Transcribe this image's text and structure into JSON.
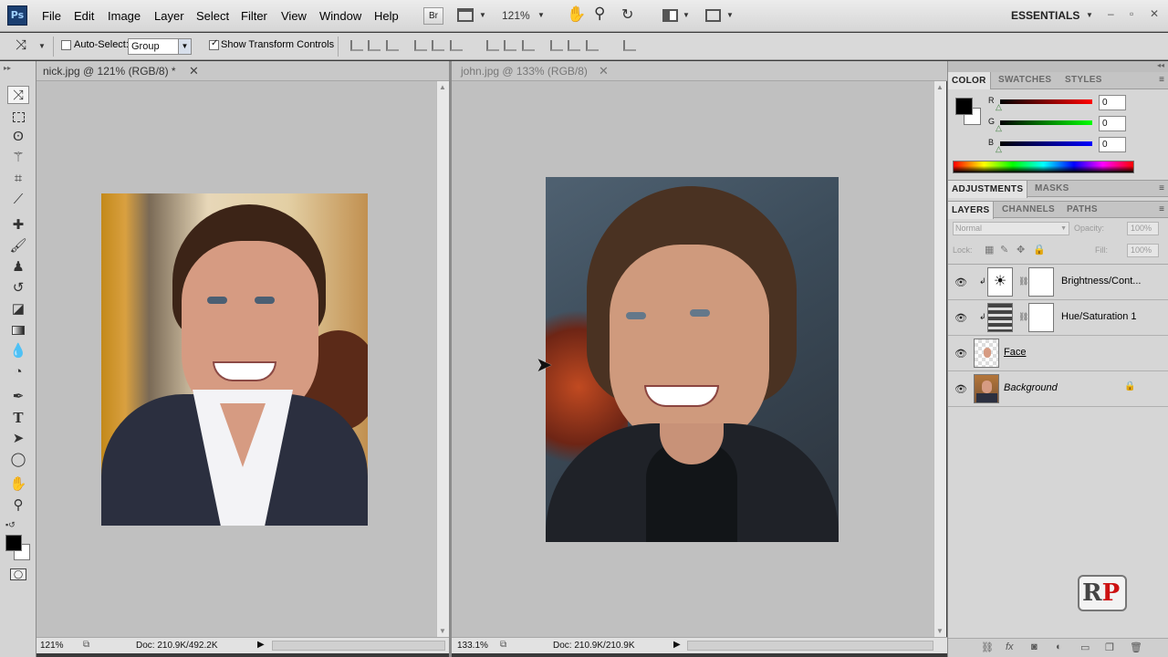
{
  "app": {
    "logo": "Ps"
  },
  "menu": [
    "File",
    "Edit",
    "Image",
    "Layer",
    "Select",
    "Filter",
    "View",
    "Window",
    "Help"
  ],
  "menubar": {
    "br_label": "Br",
    "zoom": "121%",
    "workspace": "ESSENTIALS"
  },
  "options": {
    "auto_select_label": "Auto-Select:",
    "auto_select_checked": false,
    "group_value": "Group",
    "show_transform_label": "Show Transform Controls",
    "show_transform_checked": true
  },
  "doc1": {
    "title": "nick.jpg @ 121% (RGB/8) *",
    "zoom": "121%",
    "doc_size": "Doc: 210.9K/492.2K"
  },
  "doc2": {
    "title": "john.jpg @ 133% (RGB/8)",
    "zoom": "133.1%",
    "doc_size": "Doc: 210.9K/210.9K"
  },
  "color_panel": {
    "tabs": [
      "COLOR",
      "SWATCHES",
      "STYLES"
    ],
    "r_label": "R",
    "g_label": "G",
    "b_label": "B",
    "r": "0",
    "g": "0",
    "b": "0"
  },
  "adjust_panel": {
    "tabs": [
      "ADJUSTMENTS",
      "MASKS"
    ]
  },
  "layers_panel": {
    "tabs": [
      "LAYERS",
      "CHANNELS",
      "PATHS"
    ],
    "blend_mode": "Normal",
    "opacity_label": "Opacity:",
    "opacity": "100%",
    "lock_label": "Lock:",
    "fill_label": "Fill:",
    "fill": "100%",
    "layers": [
      {
        "name": "Brightness/Cont..."
      },
      {
        "name": "Hue/Saturation 1"
      },
      {
        "name": "Face"
      },
      {
        "name": "Background"
      }
    ]
  },
  "colors": {
    "accent": "#1b3f71",
    "canvas": "#c0c0c0"
  }
}
